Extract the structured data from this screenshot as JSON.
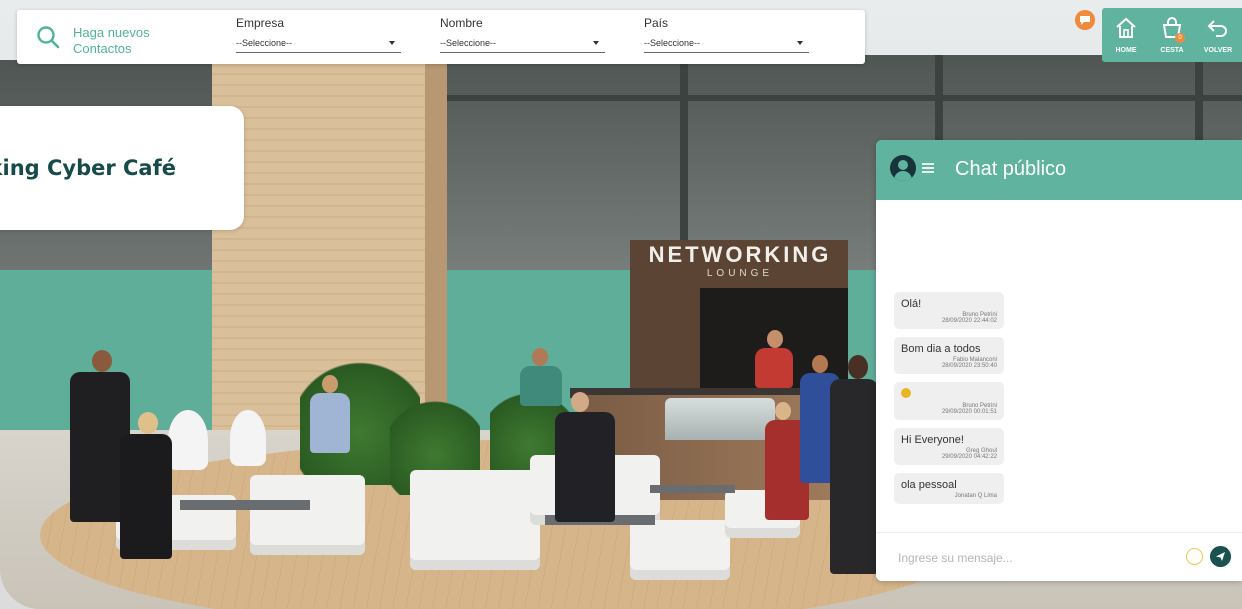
{
  "filter_bar": {
    "search_title": "Haga nuevos Contactos",
    "filters": [
      {
        "label": "Empresa",
        "value": "--Seleccione--"
      },
      {
        "label": "Nombre",
        "value": "--Seleccione--"
      },
      {
        "label": "País",
        "value": "--Seleccione--"
      }
    ]
  },
  "top_nav": {
    "items": [
      {
        "label": "HOME",
        "icon": "home-icon"
      },
      {
        "label": "CESTA",
        "icon": "basket-icon",
        "badge": "0"
      },
      {
        "label": "VOLVER",
        "icon": "back-arrow-icon"
      }
    ]
  },
  "room": {
    "title": "Espaço Networking Cyber Café"
  },
  "scene": {
    "sign": "NETWORKING",
    "sign_sub": "LOUNGE"
  },
  "chat": {
    "title": "Chat público",
    "messages": [
      {
        "text": "Olá!",
        "user": "Bruno Petrini",
        "date": "28/09/2020 22:44:02"
      },
      {
        "text": "Bom dia a todos",
        "user": "Fabio Malanconi",
        "date": "28/09/2020 23:50:40"
      },
      {
        "text": "",
        "emoji": "grin-emoji",
        "user": "Bruno Petrini",
        "date": "29/09/2020 00:01:51"
      },
      {
        "text": "Hi Everyone!",
        "user": "Greg Ghoul",
        "date": "29/09/2020 04:42:22"
      },
      {
        "text": "ola pessoal",
        "user": "Jonatan Q Lima",
        "date": ""
      }
    ],
    "input_placeholder": "Ingrese su mensaje..."
  },
  "colors": {
    "accent": "#5fb39f",
    "title_dark": "#174b4a",
    "notification": "#f08a3c"
  }
}
